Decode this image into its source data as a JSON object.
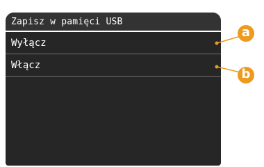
{
  "screen": {
    "title": "Zapisz w pamięci USB",
    "options": [
      {
        "label": "Wyłącz"
      },
      {
        "label": "Włącz"
      }
    ]
  },
  "callouts": {
    "a": "a",
    "b": "b",
    "color": "#ee9a1e"
  }
}
